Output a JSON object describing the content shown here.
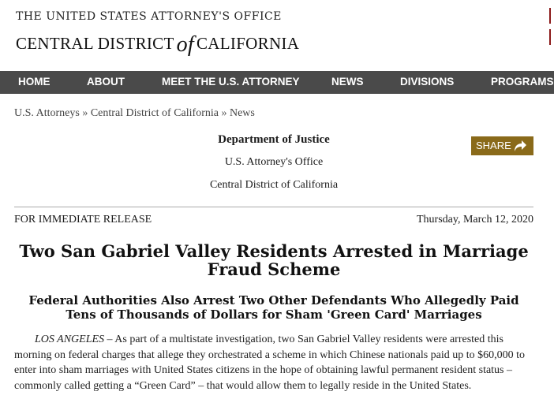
{
  "header": {
    "office": "THE UNITED STATES ATTORNEY'S OFFICE",
    "district_before": "CENTRAL DISTRICT",
    "district_of": "of",
    "district_after": "CALIFORNIA"
  },
  "nav": {
    "items": [
      "HOME",
      "ABOUT",
      "MEET THE U.S. ATTORNEY",
      "NEWS",
      "DIVISIONS",
      "PROGRAMS"
    ]
  },
  "breadcrumb": {
    "items": [
      "U.S. Attorneys",
      "Central District of California",
      "News"
    ],
    "separator": "»"
  },
  "agency": {
    "line1": "Department of Justice",
    "line2": "U.S. Attorney's Office",
    "line3": "Central District of California"
  },
  "share": {
    "label": "SHARE",
    "icon": "share-arrow-icon",
    "color": "#8a6a1a"
  },
  "release": {
    "label": "FOR IMMEDIATE RELEASE",
    "date": "Thursday, March 12, 2020"
  },
  "article": {
    "title": "Two San Gabriel Valley Residents Arrested in Marriage Fraud Scheme",
    "subtitle": "Federal Authorities Also Arrest Two Other Defendants Who Allegedly Paid Tens of Thousands of Dollars for Sham 'Green Card' Marriages",
    "dateline": "LOS ANGELES",
    "body": " – As part of a multistate investigation, two San Gabriel Valley residents were arrested this morning on federal charges that allege they orchestrated a scheme in which Chinese nationals paid up to $60,000 to enter into sham marriages with United States citizens in the hope of obtaining lawful permanent resident status – commonly called getting a “Green Card” – that would allow them to legally reside in the United States."
  },
  "colors": {
    "nav_bg": "#4a4a4a",
    "share_bg": "#8a6a1a"
  }
}
